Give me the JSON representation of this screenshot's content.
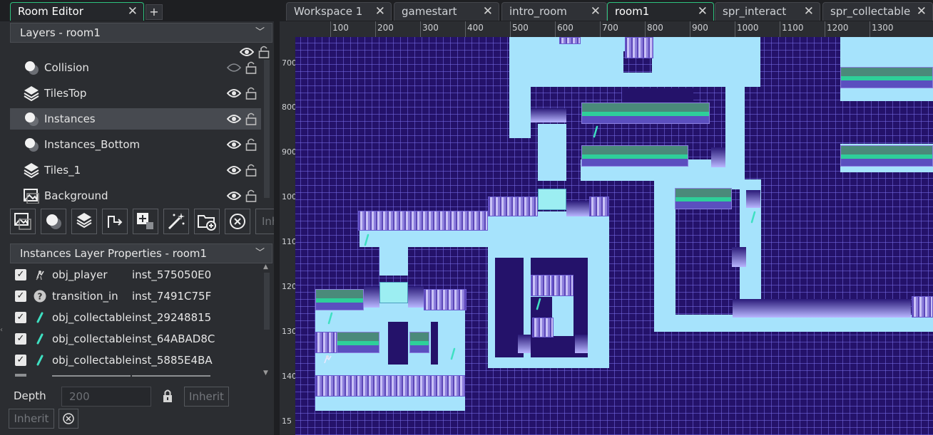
{
  "left_tabs": {
    "active": "Room Editor",
    "plus": "+"
  },
  "layers_panel": {
    "title": "Layers - room1",
    "layers": [
      {
        "name": "Collision",
        "visible": false
      },
      {
        "name": "TilesTop",
        "visible": true
      },
      {
        "name": "Instances",
        "visible": true,
        "selected": true
      },
      {
        "name": "Instances_Bottom",
        "visible": true
      },
      {
        "name": "Tiles_1",
        "visible": true
      },
      {
        "name": "Background",
        "visible": true
      }
    ],
    "toolbar_partial_label": "Inh"
  },
  "instances_panel": {
    "title": "Instances Layer Properties - room1",
    "instances": [
      {
        "object": "obj_player",
        "id": "inst_575050E0",
        "icon": "player-sprite-icon"
      },
      {
        "object": "transition_in",
        "id": "inst_7491C75F",
        "icon": "question-icon"
      },
      {
        "object": "obj_collectable",
        "id": "inst_29248815",
        "icon": "collectable-icon"
      },
      {
        "object": "obj_collectable",
        "id": "inst_64ABAD8C",
        "icon": "collectable-icon"
      },
      {
        "object": "obj_collectable",
        "id": "inst_5885E4BA",
        "icon": "collectable-icon"
      }
    ],
    "depth_label": "Depth",
    "depth_value": "200",
    "inherit_label": "Inherit",
    "inherit_label_2": "Inherit"
  },
  "editor_tabs": [
    {
      "label": "Workspace 1",
      "active": false
    },
    {
      "label": "gamestart",
      "active": false
    },
    {
      "label": "intro_room",
      "active": false
    },
    {
      "label": "room1",
      "active": true
    },
    {
      "label": "spr_interact",
      "active": false
    },
    {
      "label": "spr_collectable",
      "active": false
    }
  ],
  "ruler": {
    "h_ticks": [
      "100",
      "200",
      "300",
      "400",
      "500",
      "600",
      "700",
      "800",
      "900",
      "1000",
      "1100",
      "1200",
      "1300"
    ],
    "v_ticks": [
      "700",
      "800",
      "900",
      "1000",
      "1100",
      "1200",
      "1300",
      "1400",
      "15"
    ]
  },
  "colors": {
    "accent": "#2ec27e",
    "canvas_bg": "#24126a",
    "floor": "#a6e3fc"
  }
}
